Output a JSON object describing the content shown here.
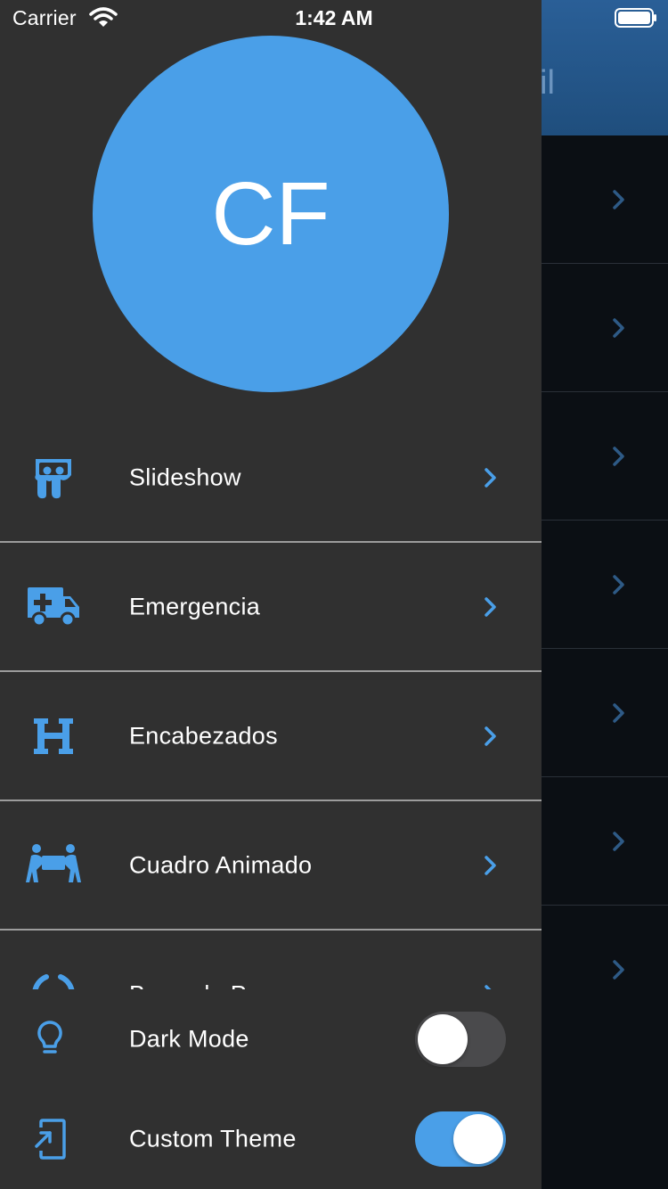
{
  "status_bar": {
    "carrier": "Carrier",
    "time": "1:42 AM",
    "wifi_icon": "wifi-icon",
    "battery_icon": "battery-icon"
  },
  "background_page": {
    "title_fragment": "il",
    "header_color": "#2a5f97",
    "row_chevron_color": "#2e5a86"
  },
  "drawer": {
    "avatar_initials": "CF",
    "avatar_color": "#4a9fe8",
    "accent_color": "#4a9fe8",
    "items": [
      {
        "label": "Slideshow",
        "icon": "slideshare-icon"
      },
      {
        "label": "Emergencia",
        "icon": "ambulance-icon"
      },
      {
        "label": "Encabezados",
        "icon": "heading-icon"
      },
      {
        "label": "Cuadro Animado",
        "icon": "people-carry-icon"
      },
      {
        "label": "Barra de Progreso",
        "icon": "circle-notch-icon"
      }
    ],
    "settings": [
      {
        "label": "Dark Mode",
        "icon": "lightbulb-icon",
        "enabled": false
      },
      {
        "label": "Custom Theme",
        "icon": "add-to-home-screen-icon",
        "enabled": true
      }
    ]
  }
}
